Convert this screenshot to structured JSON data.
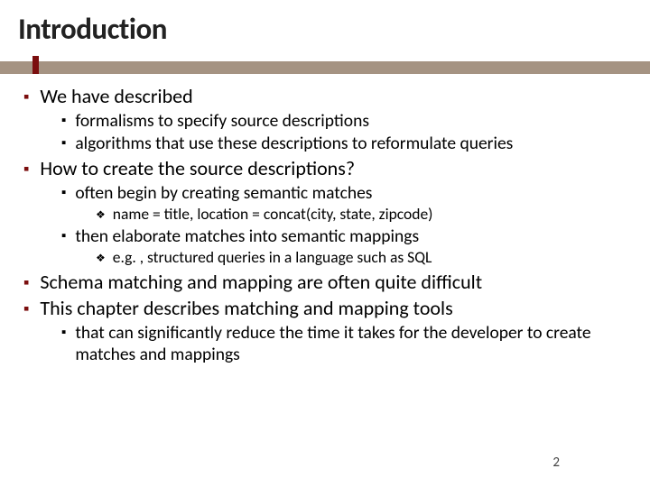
{
  "title": "Introduction",
  "b": {
    "p1": "We have described",
    "p1a": "formalisms to specify source descriptions",
    "p1b": "algorithms that use these descriptions to reformulate queries",
    "p2": "How to create the source descriptions?",
    "p2a": "often begin by creating semantic matches",
    "p2a1": "name = title, location = concat(city, state, zipcode)",
    "p2b": "then elaborate matches into semantic mappings",
    "p2b1": "e.g. , structured queries in a language such as SQL",
    "p3": "Schema matching and mapping are often quite difficult",
    "p4": "This chapter describes matching and mapping tools",
    "p4a": "that can significantly reduce the time it takes for the developer to create matches and mappings"
  },
  "page_number": "2"
}
